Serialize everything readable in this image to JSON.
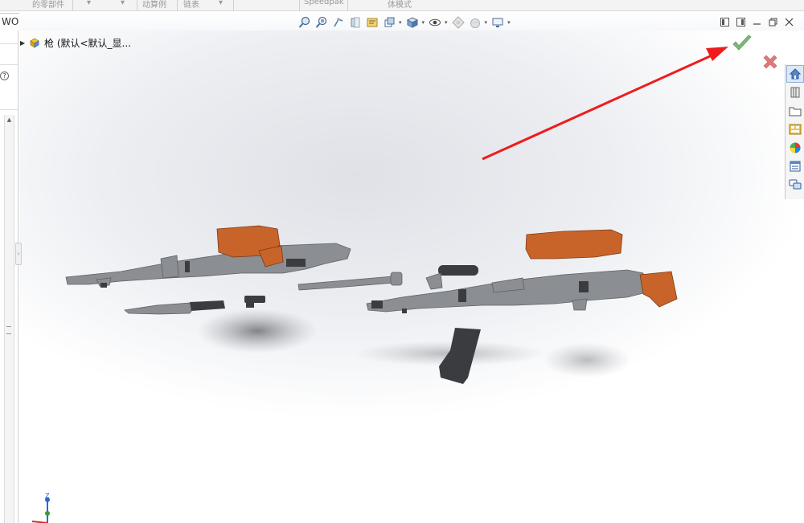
{
  "ribbon": {
    "items": [
      "的零部件",
      "动算例",
      "链表",
      "Speedpak",
      "体模式"
    ]
  },
  "tabs": {
    "active_label": "WORKS MBD"
  },
  "feature_tree": {
    "root_label": "枪 (默认<默认_显..."
  },
  "left_panel": {
    "help_glyph": "?"
  },
  "heads_up_toolbar": {
    "icons": [
      "zoom-to-fit-icon",
      "zoom-to-area-icon",
      "previous-view-icon",
      "section-view-icon",
      "dynamic-annotation-icon",
      "view-orientation-icon",
      "display-style-icon",
      "hide-show-items-icon",
      "edit-appearance-icon",
      "apply-scene-icon",
      "view-settings-icon"
    ]
  },
  "confirm": {
    "ok_color": "#7fb87a",
    "cancel_color": "#e07a7a"
  },
  "annotation": {
    "arrow_color": "#ee1c1c"
  },
  "model": {
    "metal_color": "#8b8e93",
    "wood_color": "#c8642a",
    "dark_color": "#3a3c40"
  },
  "triad": {
    "z_label": "Z"
  }
}
